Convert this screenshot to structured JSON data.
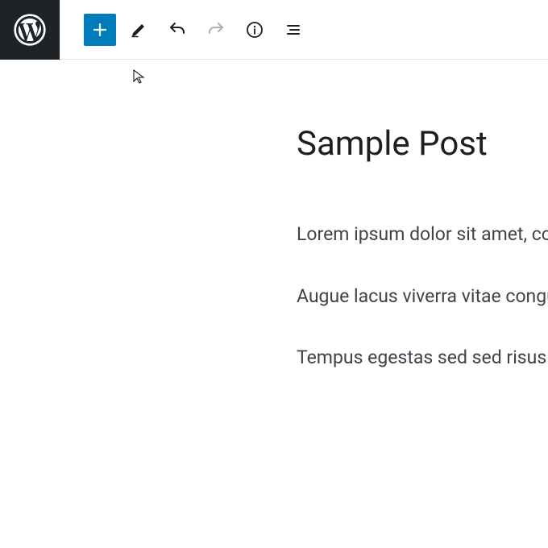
{
  "post": {
    "title": "Sample Post",
    "paragraphs": [
      "Lorem ipsum dolor sit amet, consectetur adipiscing elit, sed do eiusmod tempor incididunt ut labore et dolore magna aliqua.",
      "Augue lacus viverra vitae congue eu consequat ac. Viverra suspendisse faucibus interdum posuere lorem. Consectetur libero id faucibus nisl tincidunt eget nullam non nisi. Vulputate dignissim suspendisse in est ante in nibh mauris cursus mattis molestie a iaculis at erat pellentesque adipiscing commodo elit at imperdiet dui accumsan sit amet nulla facilisi morbi tempus iaculis urna id volutpat lacus laoreet non curabitur gravida arcu ac tortor dignissim convallis aenean et tortor at risus viverra adipiscing at in tellus varius duis at.",
      "Tempus egestas sed sed risus pretium quam vulputate. Vitae auctor eu augue ut lectus arcu bibendum at varius vel pharetra vel turpis nunc eget lorem dolor sed viverra ipsum nunc aliquet bibendum enim facilisis gravida neque convallis a cras semper auctor neque vitae tempus quam pellentesque nec nam aliquam sem et tortor consequat id porta nibh venenatis cras sed felis eget velit aliquet sagittis id consectetur purus ut faucibus pulvinar elementum integer enim neque volutpat ac tincidunt vitae semper quis lectus nulla at volutpat diam ut venenatis tellus in metus vulputate eu scelerisque felis imperdiet proin fermentum leo vel orci porta non pulvinar neque laoreet suspendisse mauris ultrices eros in cursus turpis massa tincidunt dui ut ornare lectus sit amet est placerat in egestas erat imperdiet sed euismod nisi porta lorem mollis aliquam ut porttitor leo a diam sollicitudin tempor id eu nisl nunc mi ipsum faucibus vitae aliquet nec ullamcorper sit amet risus nullam eget felis eget nunc lobortis mattis aliquam faucibus purus in massa tempor nec feugiat nisl pretium fusce id velit ut tortor pretium viverra adipiscing at in tellus integer feugiat scelerisque varius morbi enim nunc faucibus a pellentesque sit amet porttitor eget dolor morbi non arcu risus quis varius quam quisque id diam vel etiam tempor orci eu. At ultrices mi tempus imperdiet nulla malesuada pellentesque elit eget gravida cum sociis natoque penatibus et magnis dis parturient montes nascetur ridiculus mus mauris vitae ultricies leo integer malesuada nunc vel risus commodo viverra maecenas accumsan lacus vel facilisis volutpat nullam vehicula ipsum a arcu cursus vitae congue mauris."
    ]
  },
  "toolbar": {
    "add_label": "Add block",
    "tools_label": "Tools",
    "undo_label": "Undo",
    "redo_label": "Redo",
    "info_label": "Details",
    "outline_label": "Document Outline"
  }
}
